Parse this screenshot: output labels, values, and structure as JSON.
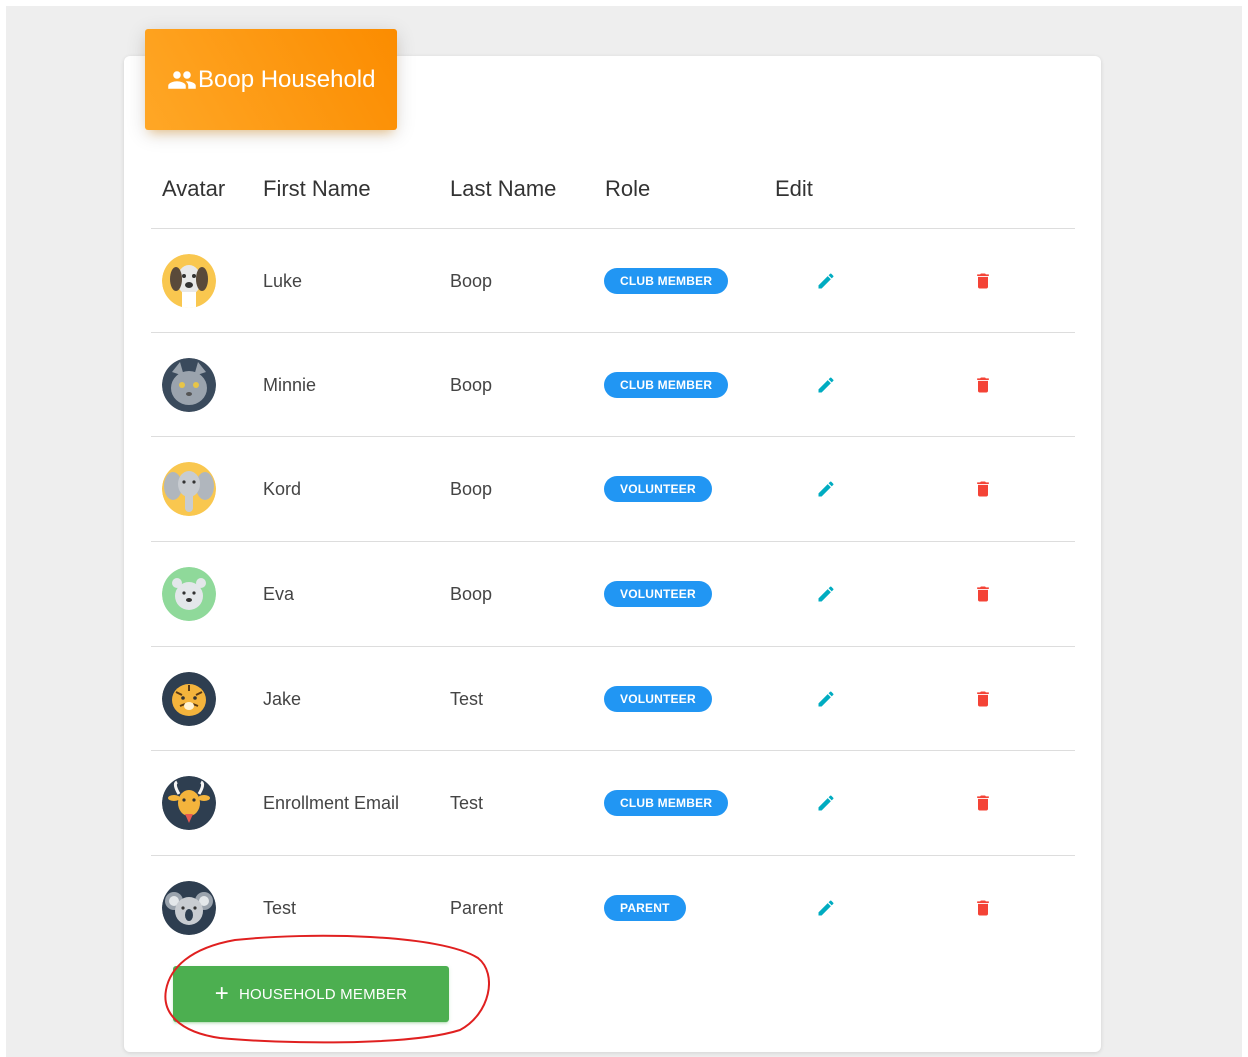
{
  "household": {
    "title": "Boop Household",
    "icon": "people-icon",
    "header_color": "#fb8c00"
  },
  "table": {
    "headers": {
      "avatar": "Avatar",
      "first_name": "First Name",
      "last_name": "Last Name",
      "role": "Role",
      "edit": "Edit"
    },
    "rows": [
      {
        "avatar": "dog-avatar",
        "first": "Luke",
        "last": "Boop",
        "role": "CLUB MEMBER"
      },
      {
        "avatar": "cat-avatar",
        "first": "Minnie",
        "last": "Boop",
        "role": "CLUB MEMBER"
      },
      {
        "avatar": "elephant-avatar",
        "first": "Kord",
        "last": "Boop",
        "role": "VOLUNTEER"
      },
      {
        "avatar": "polar-bear-avatar",
        "first": "Eva",
        "last": "Boop",
        "role": "VOLUNTEER"
      },
      {
        "avatar": "tiger-avatar",
        "first": "Jake",
        "last": "Test",
        "role": "VOLUNTEER"
      },
      {
        "avatar": "goat-avatar",
        "first": "Enrollment Email",
        "last": "Test",
        "role": "CLUB MEMBER"
      },
      {
        "avatar": "koala-avatar",
        "first": "Test",
        "last": "Parent",
        "role": "PARENT"
      }
    ],
    "edit_icon": "pencil-icon",
    "delete_icon": "trash-icon",
    "edit_color": "#00acc1",
    "delete_color": "#f44336",
    "badge_color": "#2196f3"
  },
  "add_button": {
    "icon": "plus",
    "label": "HOUSEHOLD MEMBER",
    "color": "#4caf50"
  }
}
